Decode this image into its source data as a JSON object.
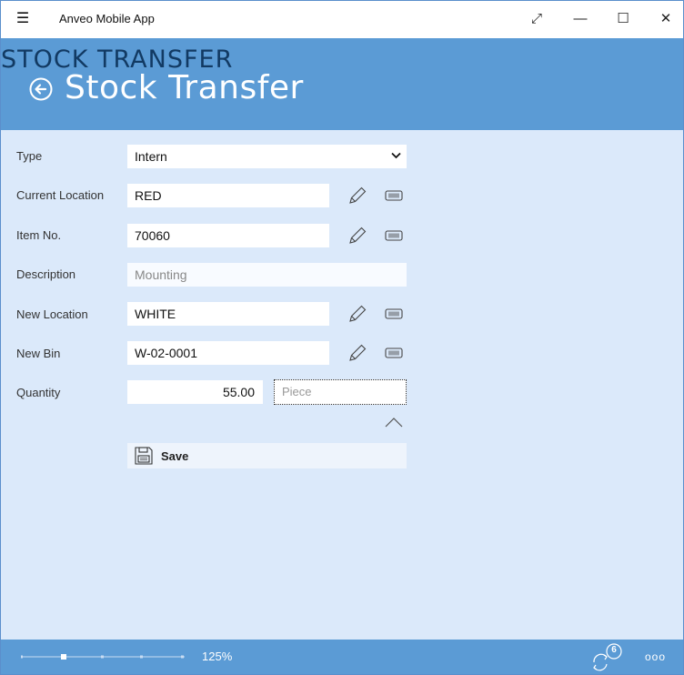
{
  "window": {
    "title": "Anveo Mobile App",
    "controls": {
      "expand": "⤢",
      "minimize": "—",
      "maximize": "☐",
      "close": "✕"
    }
  },
  "header": {
    "overlay_title": "STOCK TRANSFER",
    "title": "Stock Transfer"
  },
  "form": {
    "type": {
      "label": "Type",
      "value": "Intern"
    },
    "current_location": {
      "label": "Current Location",
      "value": "RED"
    },
    "item_no": {
      "label": "Item No.",
      "value": "70060"
    },
    "description": {
      "label": "Description",
      "value": "Mounting"
    },
    "new_location": {
      "label": "New Location",
      "value": "WHITE"
    },
    "new_bin": {
      "label": "New Bin",
      "value": "W-02-0001"
    },
    "quantity": {
      "label": "Quantity",
      "value": "55.00",
      "unit_placeholder": "Piece"
    },
    "save_label": "Save"
  },
  "statusbar": {
    "zoom": "125%",
    "sync_count": "6",
    "more": "ooo"
  },
  "colors": {
    "accent": "#5b9bd5",
    "background": "#dbe9fa",
    "overlay_title": "#123a63"
  },
  "icons": [
    "hamburger-icon",
    "back-arrow-icon",
    "pencil-icon",
    "barcode-icon",
    "chevron-up-icon",
    "floppy-disk-icon",
    "sync-icon",
    "more-icon"
  ]
}
